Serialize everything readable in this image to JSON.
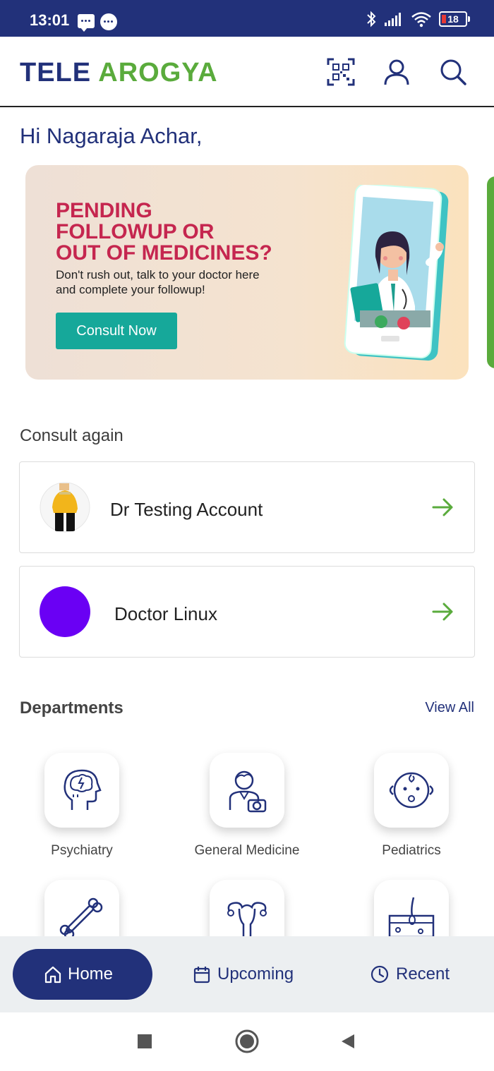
{
  "status_bar": {
    "time": "13:01",
    "battery": "18"
  },
  "header": {
    "logo_part1": "TELE",
    "logo_part2": "AROGYA"
  },
  "greeting": "Hi Nagaraja Achar,",
  "banner": {
    "title": "PENDING\nFOLLOWUP OR\nOUT OF MEDICINES?",
    "subtitle": "Don't rush out, talk to your doctor here and complete your followup!",
    "button_label": "Consult Now"
  },
  "consult_again": {
    "title": "Consult again",
    "doctors": [
      {
        "name": "Dr Testing Account"
      },
      {
        "name": "Doctor Linux"
      }
    ]
  },
  "departments": {
    "title": "Departments",
    "view_all_label": "View All",
    "items": [
      {
        "label": "Psychiatry",
        "icon": "brain-head-icon"
      },
      {
        "label": "General Medicine",
        "icon": "doctor-stethoscope-icon"
      },
      {
        "label": "Pediatrics",
        "icon": "baby-face-icon"
      },
      {
        "label": "",
        "icon": "bone-icon"
      },
      {
        "label": "",
        "icon": "uterus-icon"
      },
      {
        "label": "",
        "icon": "skin-hair-icon"
      }
    ]
  },
  "bottom_nav": {
    "home": "Home",
    "upcoming": "Upcoming",
    "recent": "Recent"
  },
  "colors": {
    "primary": "#22317a",
    "accent_green": "#5aab3c",
    "banner_title": "#c5264f",
    "button_teal": "#16a89a",
    "avatar_purple": "#6a00f4"
  }
}
